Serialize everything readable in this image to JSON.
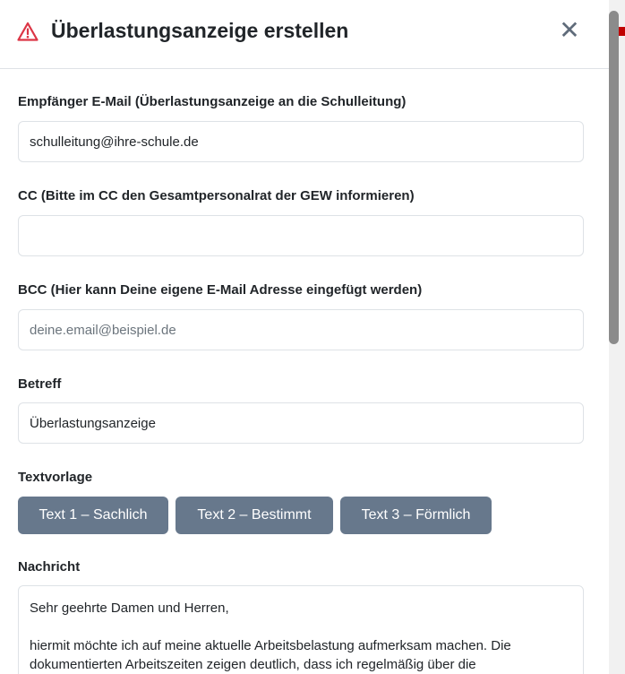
{
  "modal": {
    "title": "Überlastungsanzeige erstellen",
    "icons": {
      "warning": "warning-triangle-icon",
      "close": "close-icon"
    },
    "close_glyph": "✕"
  },
  "fields": {
    "to": {
      "label": "Empfänger E-Mail (Überlastungsanzeige an die Schulleitung)",
      "value": "schulleitung@ihre-schule.de",
      "placeholder": ""
    },
    "cc": {
      "label": "CC (Bitte im CC den Gesamtpersonalrat der GEW informieren)",
      "value": "",
      "placeholder": ""
    },
    "bcc": {
      "label": "BCC (Hier kann Deine eigene E-Mail Adresse eingefügt werden)",
      "value": "",
      "placeholder": "deine.email@beispiel.de"
    },
    "subject": {
      "label": "Betreff",
      "value": "Überlastungsanzeige",
      "placeholder": ""
    }
  },
  "templates": {
    "label": "Textvorlage",
    "buttons": [
      "Text 1 – Sachlich",
      "Text 2 – Bestimmt",
      "Text 3 – Förmlich"
    ]
  },
  "message": {
    "label": "Nachricht",
    "value": "Sehr geehrte Damen und Herren,\n\nhiermit möchte ich auf meine aktuelle Arbeitsbelastung aufmerksam machen. Die dokumentierten Arbeitszeiten zeigen deutlich, dass ich regelmäßig über die"
  },
  "colors": {
    "warning_red": "#dc3545",
    "button_bg": "#67788c",
    "border": "#dee2e6",
    "close_gray": "#5f6b7a"
  }
}
